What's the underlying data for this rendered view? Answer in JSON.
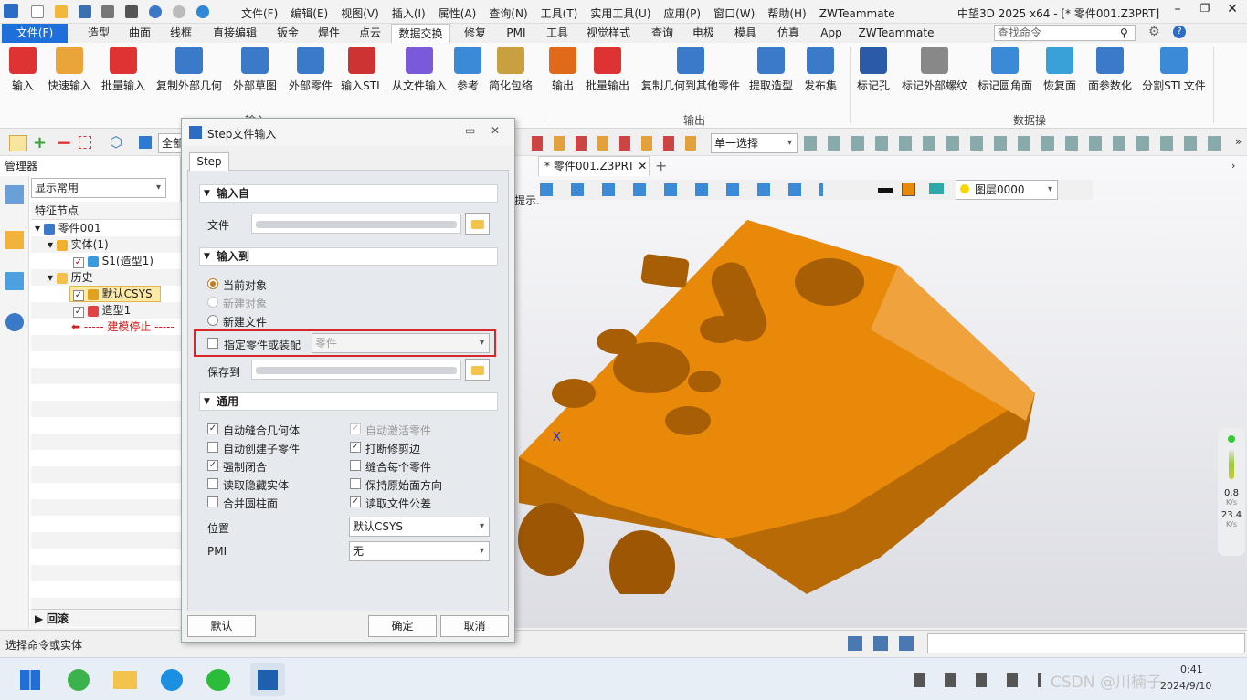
{
  "app": {
    "title": "中望3D 2025 x64 - [* 零件001.Z3PRT]"
  },
  "menu": [
    "文件(F)",
    "编辑(E)",
    "视图(V)",
    "插入(I)",
    "属性(A)",
    "查询(N)",
    "工具(T)",
    "实用工具(U)",
    "应用(P)",
    "窗口(W)",
    "帮助(H)",
    "ZWTeammate"
  ],
  "tabs": [
    "文件(F)",
    "造型",
    "曲面",
    "线框",
    "直接编辑",
    "钣金",
    "焊件",
    "点云",
    "数据交换",
    "修复",
    "PMI",
    "工具",
    "视觉样式",
    "查询",
    "电极",
    "模具",
    "仿真",
    "App",
    "ZWTeammate"
  ],
  "search": {
    "placeholder": "查找命令"
  },
  "ribbon": {
    "buttons": [
      "输入",
      "快速输入",
      "批量输入",
      "复制外部几何",
      "外部草图",
      "外部零件",
      "输入STL",
      "从文件输入",
      "参考",
      "简化包络",
      "输出",
      "批量输出",
      "复制几何到其他零件",
      "提取造型",
      "发布集",
      "标记孔",
      "标记外部螺纹",
      "标记圆角面",
      "恢复面",
      "面参数化",
      "分割STL文件"
    ],
    "groups": [
      "输入",
      "输出",
      "数据操作"
    ]
  },
  "toolbar": {
    "filter": "全部",
    "select_mode": "单一选择",
    "layer": "图层0000"
  },
  "manager": {
    "title": "管理器",
    "display": "显示常用",
    "header": "特征节点",
    "tree": [
      "零件001",
      "实体(1)",
      "S1(造型1)",
      "历史",
      "默认CSYS",
      "造型1",
      "----- 建模停止 -----"
    ],
    "rollback": "回滚"
  },
  "doc_tab": "* 零件001.Z3PRT",
  "viewport": {
    "hint": "提示.",
    "axis_x": "X",
    "perf_val1": "0.8",
    "perf_unit1": "K/s",
    "perf_val2": "23.4",
    "perf_unit2": "K/s"
  },
  "dialog": {
    "title": "Step文件输入",
    "tab": "Step",
    "sec_from": "输入自",
    "file_label": "文件",
    "sec_to": "输入到",
    "radio_current": "当前对象",
    "radio_newobj": "新建对象",
    "radio_newfile": "新建文件",
    "specify_label": "指定零件或装配",
    "specify_value": "零件",
    "save_to": "保存到",
    "sec_general": "通用",
    "opts_left": [
      "自动缝合几何体",
      "自动创建子零件",
      "强制闭合",
      "读取隐藏实体",
      "合并圆柱面"
    ],
    "opts_right": [
      "自动激活零件",
      "打断修剪边",
      "缝合每个零件",
      "保持原始面方向",
      "读取文件公差"
    ],
    "pos_label": "位置",
    "pos_value": "默认CSYS",
    "pmi_label": "PMI",
    "pmi_value": "无",
    "btn_default": "默认",
    "btn_ok": "确定",
    "btn_cancel": "取消"
  },
  "status": {
    "text": "选择命令或实体"
  },
  "taskbar": {
    "date": "2024/9/10",
    "watermark": "CSDN @川楠子",
    "time": "0:41"
  },
  "colors": {
    "accent": "#1e6fd9",
    "part": "#e8890a",
    "highlight": "#d8262b"
  }
}
